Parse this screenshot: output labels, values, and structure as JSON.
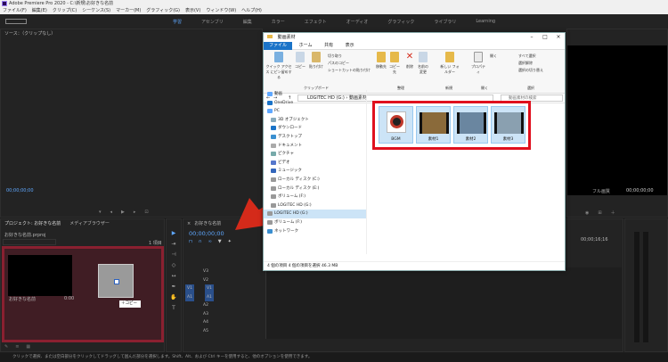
{
  "premiere": {
    "title": "Adobe Premiere Pro 2020 - C:\\新規\\お好きな名前",
    "menu": [
      "ファイル(F)",
      "編集(E)",
      "クリップ(C)",
      "シーケンス(S)",
      "マーカー(M)",
      "グラフィック(G)",
      "表示(V)",
      "ウィンドウ(W)",
      "ヘルプ(H)"
    ],
    "workspaces": [
      "学習",
      "アセンブリ",
      "編集",
      "カラー",
      "エフェクト",
      "オーディオ",
      "グラフィック",
      "ライブラリ",
      "Learning"
    ],
    "active_workspace": "学習",
    "source_label": "ソース：（クリップなし）",
    "source_timecode": "00;00;00;00",
    "program_fit": "フル画質",
    "program_timecode": "00;00;00;00",
    "project_tabs": [
      "プロジェクト: お好きな名前",
      "メディアブラウザー"
    ],
    "project_file": "お好きな名前.prproj",
    "project_count": "1 項目",
    "bin_item": "お好きな名前",
    "bin_duration": "0:00",
    "copy_tooltip": "コピー",
    "timeline_tab": "お好きな名前",
    "timeline_timecode": "00;00;00;00",
    "ruler_label": "00;00;16;16",
    "video_tracks": [
      "V3",
      "V2",
      "V1"
    ],
    "audio_tracks": [
      "A1",
      "A2",
      "A3",
      "A4",
      "A5"
    ],
    "status_text": "クリックで選択、または空白部分をクリックしてドラッグして囲んだ部分を選択します。Shift、Alt、および Ctrl キーを使用すると、他のオプションを使用できます。"
  },
  "explorer": {
    "title": "動画素材",
    "tabs": [
      "ファイル",
      "ホーム",
      "共有",
      "表示"
    ],
    "ribbon": {
      "pin": "クイック アクセス にピン留めする",
      "copy": "コピー",
      "paste": "貼り付け",
      "cut": "切り取り",
      "copy_path": "パスのコピー",
      "paste_shortcut": "ショートカットの貼り付け",
      "group_clipboard": "クリップボード",
      "move": "移動先",
      "copy_to": "コピー先",
      "delete": "削除",
      "rename": "名前の変更",
      "group_organize": "整理",
      "new_folder": "新しい フォルダー",
      "group_new": "新規",
      "properties": "プロパティ",
      "open": "開く",
      "group_open": "開く",
      "select_all": "すべて選択",
      "select_none": "選択解除",
      "invert": "選択の切り替え",
      "group_select": "選択"
    },
    "address": "LOGITEC HD (G:)  ›  動画素材",
    "search_placeholder": "動画素材の検索",
    "nav": [
      "動画",
      "OneDrive",
      "PC",
      "3D オブジェクト",
      "ダウンロード",
      "デスクトップ",
      "ドキュメント",
      "ピクチャ",
      "ビデオ",
      "ミュージック",
      "ローカル ディスク (C:)",
      "ローカル ディスク (E:)",
      "ボリューム (F:)",
      "LOGITEC HD (G:)",
      "LOGITEC HD (G:)",
      "ボリューム (F:)",
      "ネットワーク"
    ],
    "files": [
      "BGM",
      "素材1",
      "素材2",
      "素材3"
    ],
    "status": "4 個の項目   4 個の項目を選択  46.3 MB"
  },
  "colors": {
    "arrow": "#d42a1a",
    "highlight": "#e0101e",
    "accent": "#1a73c8"
  }
}
